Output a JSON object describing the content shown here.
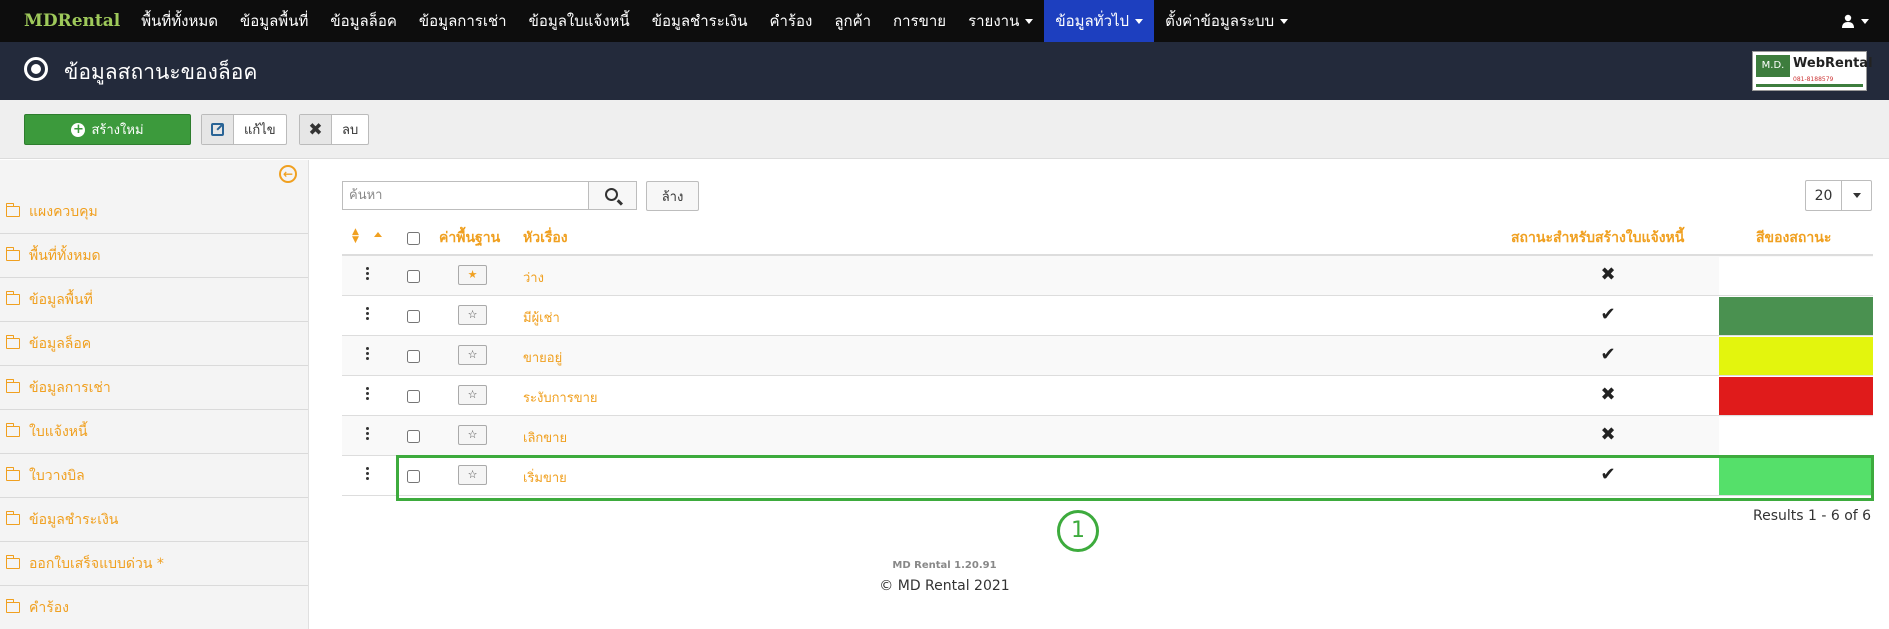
{
  "navbar": {
    "brand": "MDRental",
    "items": [
      {
        "label": "พื้นที่ทั้งหมด"
      },
      {
        "label": "ข้อมูลพื้นที่"
      },
      {
        "label": "ข้อมูลล็อค"
      },
      {
        "label": "ข้อมูลการเช่า"
      },
      {
        "label": "ข้อมูลใบแจ้งหนี้"
      },
      {
        "label": "ข้อมูลชำระเงิน"
      },
      {
        "label": "คำร้อง"
      },
      {
        "label": "ลูกค้า"
      },
      {
        "label": "การขาย"
      },
      {
        "label": "รายงาน"
      },
      {
        "label": "ข้อมูลทั่วไป"
      },
      {
        "label": "ตั้งค่าข้อมูลระบบ"
      }
    ],
    "user_icon": "user-icon"
  },
  "header": {
    "title": "ข้อมูลสถานะของล็อค",
    "logo": {
      "badge": "M.D.",
      "name": "WebRental",
      "phone": "081-8188579"
    }
  },
  "toolbar": {
    "new_label": "สร้างใหม่",
    "edit_label": "แก้ไข",
    "delete_label": "ลบ"
  },
  "sidebar": {
    "items": [
      {
        "label": "แผงควบคุม"
      },
      {
        "label": "พื้นที่ทั้งหมด"
      },
      {
        "label": "ข้อมูลพื้นที่"
      },
      {
        "label": "ข้อมูลล็อค"
      },
      {
        "label": "ข้อมูลการเช่า"
      },
      {
        "label": "ใบแจ้งหนี้"
      },
      {
        "label": "ใบวางบิล"
      },
      {
        "label": "ข้อมูลชำระเงิน"
      },
      {
        "label": "ออกใบเสร็จแบบด่วน *"
      },
      {
        "label": "คำร้อง"
      }
    ]
  },
  "search": {
    "placeholder": "ค้นหา",
    "value": "",
    "clear_label": "ล้าง"
  },
  "pagination": {
    "page_size": "20",
    "results": "Results 1 - 6 of 6"
  },
  "table": {
    "headers": {
      "default": "ค่าพื้นฐาน",
      "title": "หัวเรื่อง",
      "invoice_status": "สถานะสำหรับสร้างใบแจ้งหนี้",
      "color": "สีของสถานะ"
    },
    "rows": [
      {
        "name": "ว่าง",
        "default": true,
        "mark": "✖",
        "color": "#ffffff"
      },
      {
        "name": "มีผู้เช่า",
        "default": false,
        "mark": "✔",
        "color": "#4a9150"
      },
      {
        "name": "ขายอยู่",
        "default": false,
        "mark": "✔",
        "color": "#e3f50d"
      },
      {
        "name": "ระงับการขาย",
        "default": false,
        "mark": "✖",
        "color": "#e01b1b"
      },
      {
        "name": "เลิกขาย",
        "default": false,
        "mark": "✖",
        "color": "#ffffff"
      },
      {
        "name": "เริ่มขาย",
        "default": false,
        "mark": "✔",
        "color": "#55e06a"
      }
    ]
  },
  "annotation": {
    "number": "1"
  },
  "footer": {
    "version": "MD Rental 1.20.91",
    "copyright": "© MD Rental 2021"
  }
}
